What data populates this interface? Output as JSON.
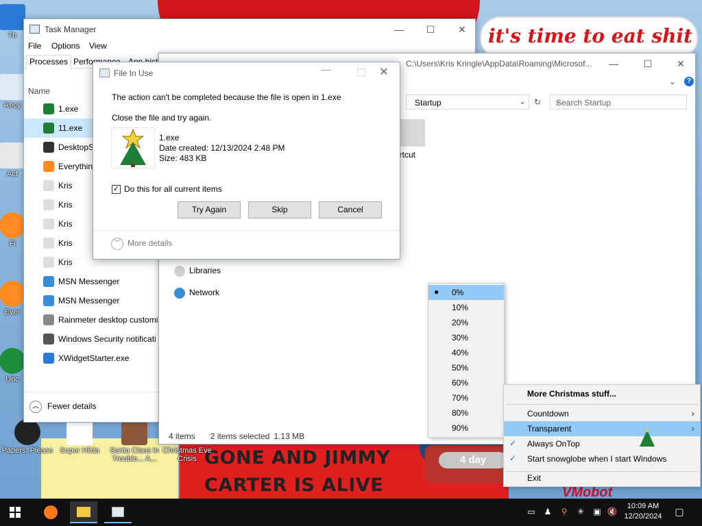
{
  "desktop": {
    "banner_top": "it's time to eat shit",
    "banner_bottom_1": "GONE AND JIMMY",
    "banner_bottom_2": "CARTER IS ALIVE",
    "globe_label": "4 day",
    "vmobot": "VMobot",
    "icons": [
      {
        "label": "Th",
        "glyph": "folder-icon"
      },
      {
        "label": "Recy",
        "glyph": "recycle-bin-icon"
      },
      {
        "label": "Act",
        "glyph": "app-icon"
      },
      {
        "label": "Fi",
        "glyph": "firefox-icon"
      },
      {
        "label": "Ever",
        "glyph": "everything-icon"
      },
      {
        "label": "Unc",
        "glyph": "app-icon"
      },
      {
        "label": "Papers, Please",
        "glyph": "game-icon"
      },
      {
        "label": "Super Hilda",
        "glyph": "game-icon"
      },
      {
        "label": "Santa Claus in Trouble... A...",
        "glyph": "game-icon"
      },
      {
        "label": "Christmas Eve Crisis",
        "glyph": "game-icon"
      }
    ]
  },
  "task_manager": {
    "title": "Task Manager",
    "menu": [
      "File",
      "Options",
      "View"
    ],
    "tabs": [
      "Processes",
      "Performance",
      "App hist"
    ],
    "column_name": "Name",
    "processes": [
      {
        "name": "1.exe",
        "icon": "tree-icon",
        "selected": false
      },
      {
        "name": "11.exe",
        "icon": "tree-icon",
        "selected": true
      },
      {
        "name": "DesktopSn",
        "icon": "snowflake-icon",
        "selected": false
      },
      {
        "name": "Everything",
        "icon": "search-icon",
        "selected": false
      },
      {
        "name": "Kris",
        "icon": "file-icon",
        "selected": false
      },
      {
        "name": "Kris",
        "icon": "file-icon",
        "selected": false
      },
      {
        "name": "Kris",
        "icon": "file-icon",
        "selected": false
      },
      {
        "name": "Kris",
        "icon": "file-icon",
        "selected": false
      },
      {
        "name": "Kris",
        "icon": "file-icon",
        "selected": false
      },
      {
        "name": "MSN Messenger",
        "icon": "msn-icon",
        "selected": false
      },
      {
        "name": "MSN Messenger",
        "icon": "msn-icon",
        "selected": false
      },
      {
        "name": "Rainmeter desktop customiz",
        "icon": "rainmeter-icon",
        "selected": false
      },
      {
        "name": "Windows Security notificati",
        "icon": "shield-icon",
        "selected": false
      },
      {
        "name": "XWidgetStarter.exe",
        "icon": "widget-icon",
        "selected": false
      }
    ],
    "fewer_details": "Fewer details"
  },
  "explorer": {
    "path": "C:\\Users\\Kris Kringle\\AppData\\Roaming\\Microsof...",
    "address_current": "Startup",
    "search_placeholder": "Search Startup",
    "shortcut_label": "ortcut",
    "nav": [
      {
        "label": "Libraries",
        "icon": "libraries-icon"
      },
      {
        "label": "Network",
        "icon": "network-icon"
      }
    ],
    "status_items": "4 items",
    "status_selected": "2 items selected",
    "status_size": "1.13 MB"
  },
  "dialog": {
    "title": "File In Use",
    "message": "The action can't be completed because the file is open in 1.exe",
    "message2": "Close the file and try again.",
    "file_name": "1.exe",
    "file_created": "Date created: 12/13/2024 2:48 PM",
    "file_size": "Size: 483 KB",
    "checkbox_label": "Do this for all current items",
    "checkbox_checked": true,
    "buttons": {
      "try_again": "Try Again",
      "skip": "Skip",
      "cancel": "Cancel"
    },
    "more_details": "More details"
  },
  "percent_menu": {
    "items": [
      "0%",
      "10%",
      "20%",
      "30%",
      "40%",
      "50%",
      "60%",
      "70%",
      "80%",
      "90%"
    ],
    "selected_index": 0
  },
  "context_menu": {
    "header": "More Christmas stuff...",
    "items": [
      {
        "label": "Countdown",
        "submenu": true,
        "checked": false,
        "highlighted": false
      },
      {
        "label": "Transparent",
        "submenu": true,
        "checked": false,
        "highlighted": true
      },
      {
        "label": "Always OnTop",
        "submenu": false,
        "checked": true,
        "highlighted": false
      },
      {
        "label": "Start snowglobe when I start Windows",
        "submenu": false,
        "checked": true,
        "highlighted": false
      }
    ],
    "exit": "Exit"
  },
  "taskbar": {
    "time": "10:09 AM",
    "date": "12/20/2024",
    "pinned": [
      "windows-start-icon",
      "firefox-icon",
      "file-explorer-icon",
      "task-manager-icon"
    ]
  },
  "colors": {
    "accent": "#91c9f7",
    "selection": "#cce8ff",
    "banner_red": "#d3161a"
  }
}
